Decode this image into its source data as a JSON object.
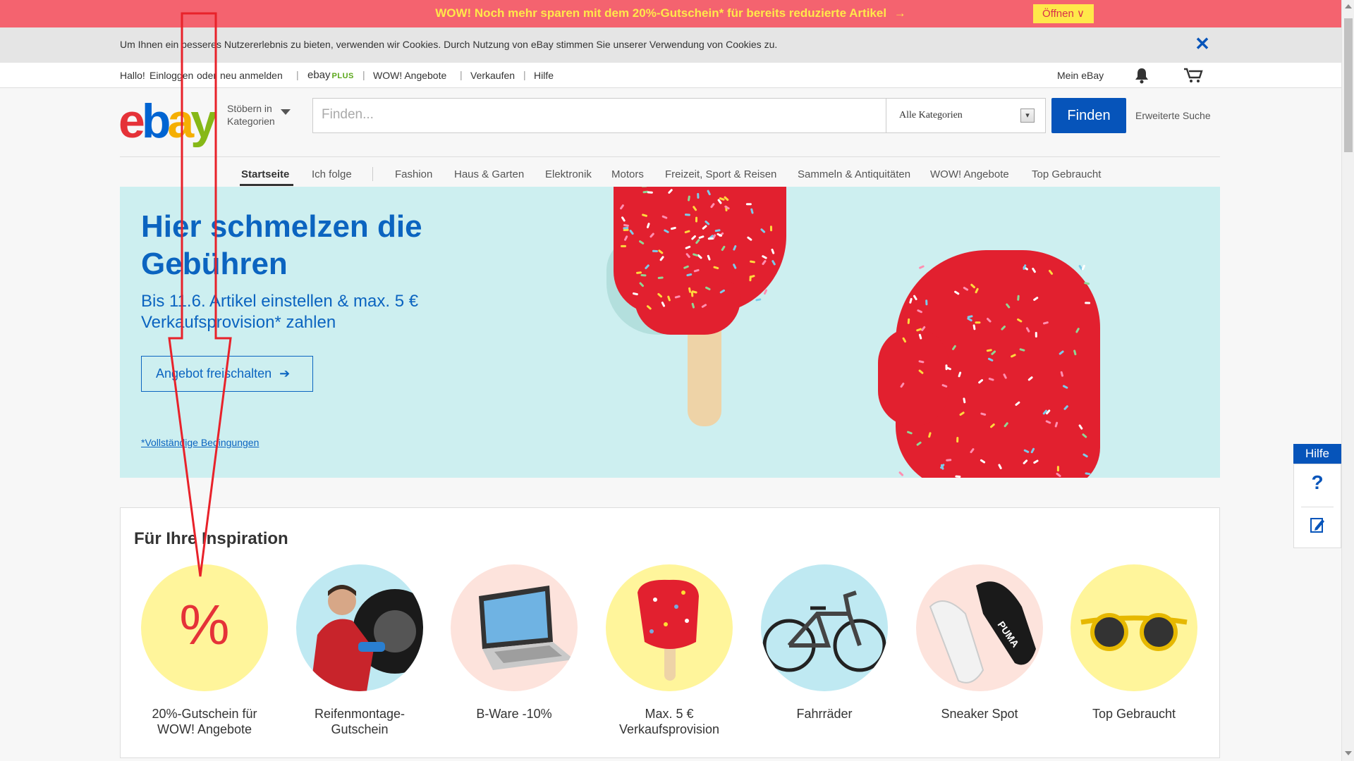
{
  "promo": {
    "text": "WOW! Noch mehr sparen mit dem 20%-Gutschein* für bereits reduzierte Artikel",
    "arrow": "→",
    "open_label": "Öffnen",
    "open_caret": "∨",
    "colors": {
      "bg": "#f4636f",
      "text": "#ffe84a"
    }
  },
  "cookie": {
    "text": "Um Ihnen ein besseres Nutzererlebnis zu bieten, verwenden wir Cookies. Durch Nutzung von eBay stimmen Sie unserer Verwendung von Cookies zu.",
    "close_icon": "close-icon",
    "close_glyph": "✕"
  },
  "topnav": {
    "greeting": "Hallo!",
    "login": "Einloggen",
    "or": "oder",
    "register": "neu anmelden",
    "plus_ebay": "ebay",
    "plus_word": "PLUS",
    "wow": "WOW! Angebote",
    "sell": "Verkaufen",
    "help": "Hilfe",
    "my_ebay": "Mein eBay",
    "bell_icon": "bell-icon",
    "cart_icon": "cart-icon"
  },
  "header": {
    "logo": {
      "e": "e",
      "b": "b",
      "a": "a",
      "y": "y"
    },
    "browse_line1": "Stöbern in",
    "browse_line2": "Kategorien",
    "search_placeholder": "Finden...",
    "category_selected": "Alle Kategorien",
    "find_button": "Finden",
    "advanced": "Erweiterte Suche",
    "colors": {
      "primary": "#0654ba"
    }
  },
  "catnav": {
    "items": [
      "Startseite",
      "Ich folge",
      "Fashion",
      "Haus & Garten",
      "Elektronik",
      "Motors",
      "Freizeit, Sport & Reisen",
      "Sammeln & Antiquitäten",
      "WOW! Angebote",
      "Top Gebraucht"
    ],
    "active": "Startseite"
  },
  "hero": {
    "title": "Hier schmelzen die Gebühren",
    "subtitle": "Bis 11.6. Artikel einstellen & max. 5 € Verkaufsprovision* zahlen",
    "button": "Angebot freischalten",
    "button_arrow": "➔",
    "terms": "*Vollständige Bedingungen",
    "colors": {
      "bg": "#cdeff0",
      "text": "#0b64c0",
      "popsicle": "#e2202f"
    }
  },
  "inspiration": {
    "title": "Für Ihre Inspiration",
    "tiles": [
      {
        "label": "20%-Gutschein für WOW! Angebote",
        "circle": "#fff59b",
        "icon": "percent-icon",
        "glyph": "%"
      },
      {
        "label": "Reifenmontage-Gutschein",
        "circle": "#bfe9f2",
        "icon": "mechanic-image"
      },
      {
        "label": "B-Ware -10%",
        "circle": "#fde3dc",
        "icon": "laptop-image"
      },
      {
        "label": "Max. 5 € Verkaufsprovision",
        "circle": "#fff59b",
        "icon": "popsicle-image"
      },
      {
        "label": "Fahrräder",
        "circle": "#bfe9f2",
        "icon": "bicycle-image"
      },
      {
        "label": "Sneaker Spot",
        "circle": "#fde3dc",
        "icon": "sneaker-image",
        "brand_text": "PUMA"
      },
      {
        "label": "Top Gebraucht",
        "circle": "#fff59b",
        "icon": "sunglasses-image"
      }
    ]
  },
  "help_widget": {
    "tab": "Hilfe",
    "question_glyph": "?",
    "question_icon": "question-icon",
    "feedback_icon": "feedback-edit-icon"
  },
  "annotation": {
    "icon": "red-arrow-annotation",
    "color": "#e8222a"
  }
}
